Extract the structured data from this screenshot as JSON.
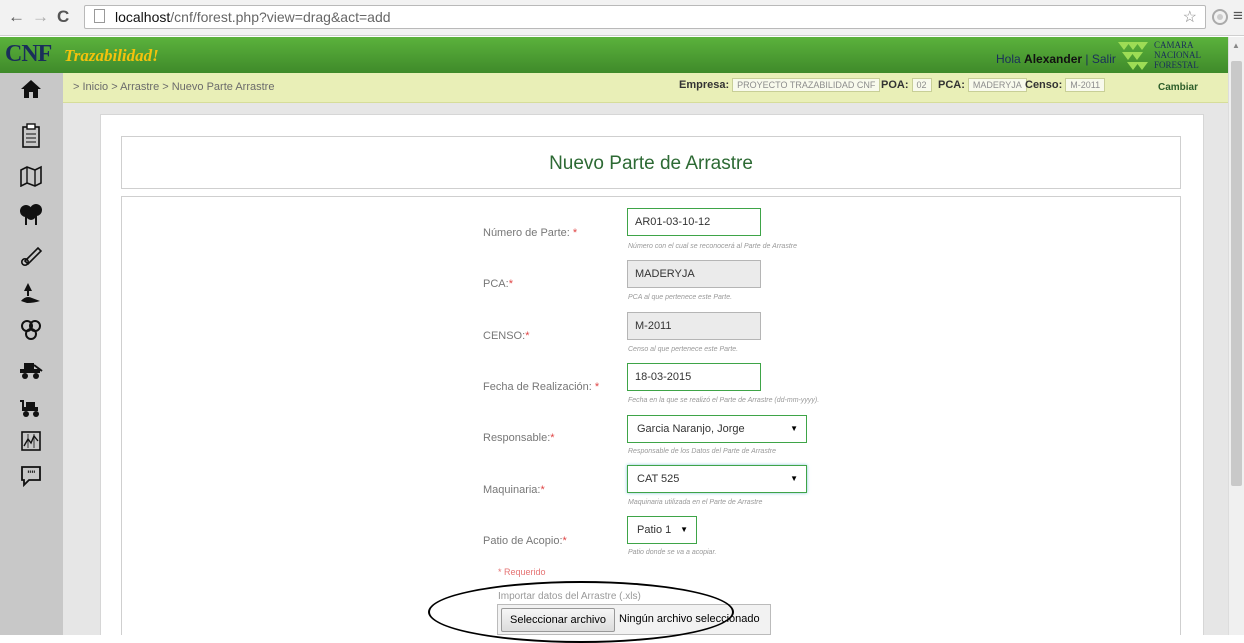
{
  "browser": {
    "url_host": "localhost",
    "url_path": "/cnf/forest.php?view=drag&act=add"
  },
  "header": {
    "logo_main": "CNF",
    "logo_sub": "Trazabilidad!",
    "greeting_prefix": "Hola",
    "user_name": "Alexander",
    "separator": "|",
    "logout": "Salir",
    "brand_lines": [
      "CAMARA",
      "NACIONAL",
      "FORESTAL"
    ]
  },
  "breadcrumb": "> Inicio > Arrastre > Nuevo Parte Arrastre",
  "context": {
    "empresa_label": "Empresa:",
    "empresa_value": "PROYECTO TRAZABILIDAD CNF",
    "poa_label": "POA:",
    "poa_value": "02",
    "pca_label": "PCA:",
    "pca_value": "MADERYJA",
    "censo_label": "Censo:",
    "censo_value": "M-2011",
    "change": "Cambiar"
  },
  "sidebar": {
    "icons": [
      "home-icon",
      "clipboard-icon",
      "map-icon",
      "trees-icon",
      "chainsaw-icon",
      "tree-felling-icon",
      "logs-icon",
      "skidder-icon",
      "loader-icon",
      "chart-icon",
      "comment-icon"
    ]
  },
  "page_title": "Nuevo Parte de Arrastre",
  "form": {
    "numero": {
      "label": "Número de Parte:",
      "req": "*",
      "value": "AR01-03-10-12",
      "help": "Número con el cual se reconocerá al Parte de Arrastre"
    },
    "pca": {
      "label": "PCA:",
      "req": "*",
      "value": "MADERYJA",
      "help": "PCA al que pertenece este Parte."
    },
    "censo": {
      "label": "CENSO:",
      "req": "*",
      "value": "M-2011",
      "help": "Censo al que pertenece este Parte."
    },
    "fecha": {
      "label": "Fecha de Realización:",
      "req": "*",
      "value": "18-03-2015",
      "help": "Fecha en la que se realizó el Parte de Arrastre (dd-mm-yyyy)."
    },
    "responsable": {
      "label": "Responsable:",
      "req": "*",
      "value": "Garcia Naranjo, Jorge",
      "help": "Responsable de los Datos del Parte de Arrastre"
    },
    "maquinaria": {
      "label": "Maquinaria:",
      "req": "*",
      "value": "CAT 525",
      "help": "Maquinaria utilizada en el Parte de Arrastre"
    },
    "patio": {
      "label": "Patio de Acopio:",
      "req": "*",
      "value": "Patio 1",
      "help": "Patio donde se va a acopiar."
    },
    "required_note": "* Requerido",
    "import_label": "Importar datos del Arrastre (.xls)",
    "file_button": "Seleccionar archivo",
    "file_status": "Ningún archivo seleccionado"
  }
}
